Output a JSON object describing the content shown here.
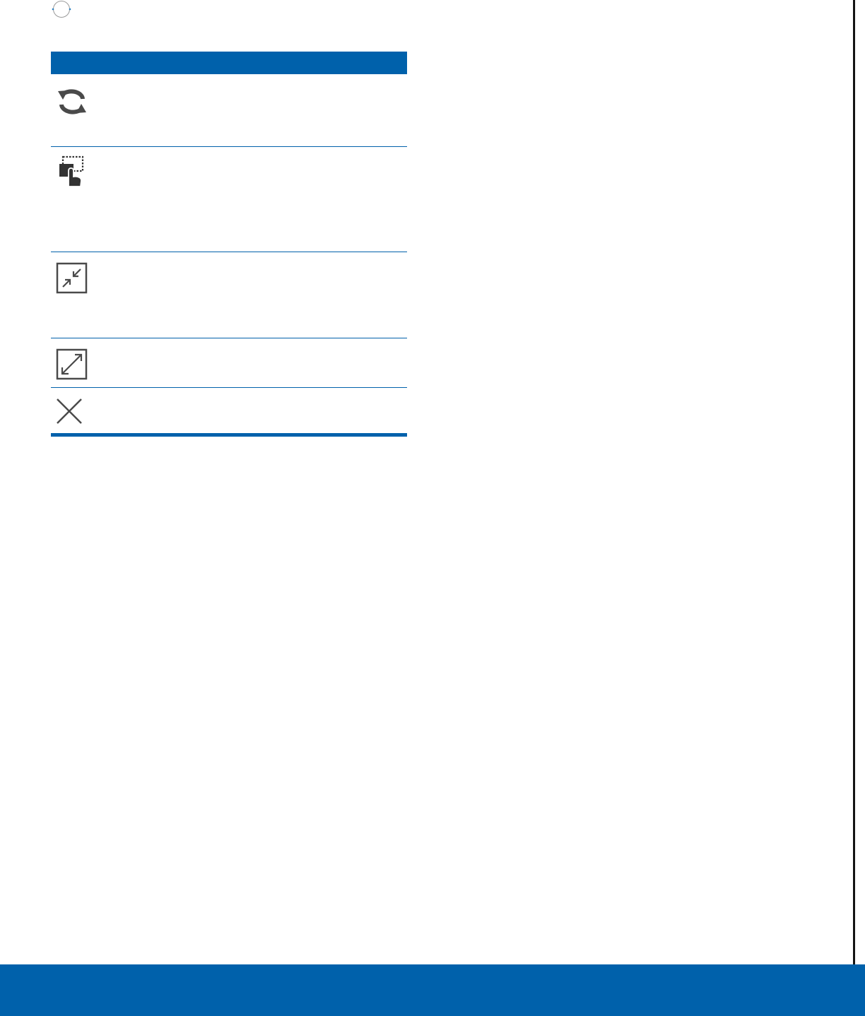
{
  "page": {
    "colors": {
      "accent": "#0061ab",
      "icon": "#4a4a4a",
      "page_edge": "#141414"
    }
  },
  "table": {
    "header_label": "",
    "rows": [
      {
        "icon": "swap-arrows-icon",
        "description": ""
      },
      {
        "icon": "touch-select-icon",
        "description": ""
      },
      {
        "icon": "minimize-window-icon",
        "description": ""
      },
      {
        "icon": "maximize-window-icon",
        "description": ""
      },
      {
        "icon": "close-icon",
        "description": ""
      }
    ]
  }
}
